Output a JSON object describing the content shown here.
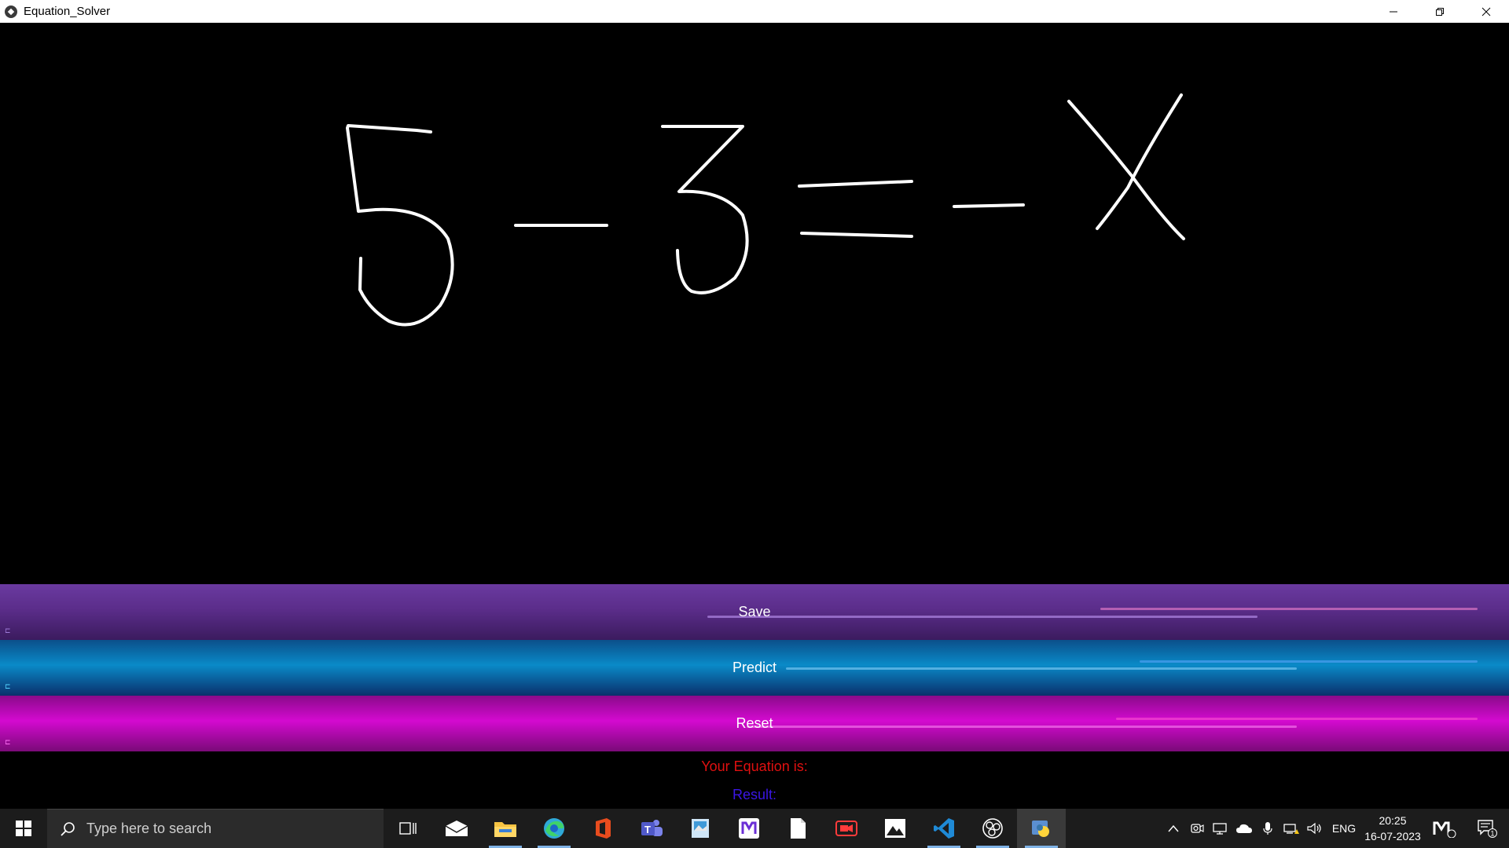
{
  "window": {
    "title": "Equation_Solver"
  },
  "canvas": {
    "drawn_equation_strokes": [
      "5",
      "-",
      "3",
      "=",
      "-",
      "X"
    ]
  },
  "buttons": {
    "save_label": "Save",
    "predict_label": "Predict",
    "reset_label": "Reset"
  },
  "output": {
    "equation_label": "Your Equation is:",
    "result_label": "Result:"
  },
  "taskbar": {
    "search_placeholder": "Type here to search",
    "language": "ENG",
    "time": "20:25",
    "date": "16-07-2023",
    "notification_count": "1",
    "pinned_apps": [
      "task-view",
      "mail",
      "file-explorer",
      "edge",
      "office",
      "teams",
      "photos-viewer",
      "code-app",
      "notepad",
      "screen-recorder",
      "photos",
      "vscode",
      "obs",
      "python"
    ]
  },
  "colors": {
    "equation_label": "#e01010",
    "result_label": "#3b16e6",
    "canvas_bg": "#000000",
    "stroke": "#ffffff"
  }
}
